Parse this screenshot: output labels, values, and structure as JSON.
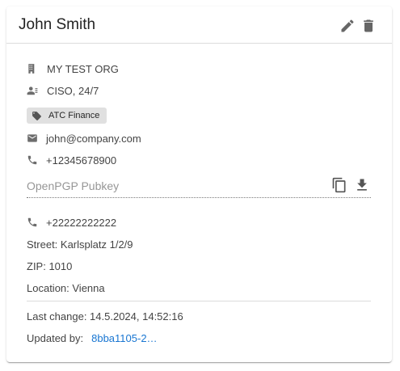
{
  "card": {
    "title": "John Smith",
    "actions": {
      "edit_icon": "pencil-icon",
      "delete_icon": "trash-icon"
    }
  },
  "details": {
    "organization": "MY TEST ORG",
    "role": "CISO, 24/7",
    "tag": "ATC Finance",
    "email": "john@company.com",
    "phone": "+12345678900"
  },
  "pgp": {
    "label": "OpenPGP Pubkey",
    "copy_icon": "copy-icon",
    "download_icon": "download-icon"
  },
  "address": {
    "phone": "+22222222222",
    "street": "Street: Karlsplatz 1/2/9",
    "zip": "ZIP: 1010",
    "location": "Location: Vienna"
  },
  "meta": {
    "last_change": "Last change: 14.5.2024, 14:52:16",
    "updated_by_label": "Updated by:",
    "updated_by_value": "8bba1105-2…"
  },
  "colors": {
    "link": "#1976d2",
    "icon": "#666666",
    "chip_bg": "#e0e0e0"
  }
}
